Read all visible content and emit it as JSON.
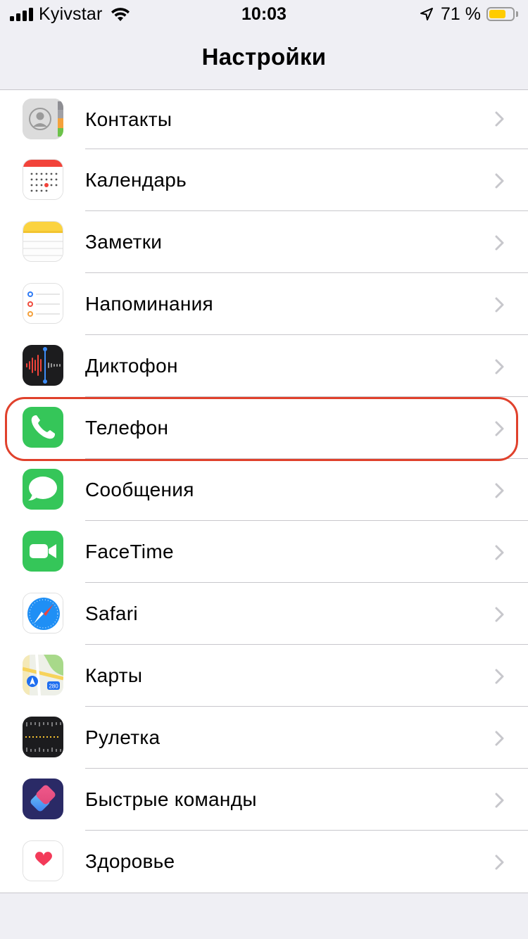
{
  "status_bar": {
    "carrier": "Kyivstar",
    "time": "10:03",
    "battery_text": "71 %",
    "battery_level": 0.71,
    "signal_icon": "cellular-signal-icon",
    "wifi_icon": "wifi-icon",
    "location_icon": "location-arrow-icon",
    "battery_icon": "battery-icon",
    "battery_color": "#ffcc00"
  },
  "nav": {
    "title": "Настройки"
  },
  "highlight_color": "#e0412c",
  "settings": {
    "items": [
      {
        "label": "Контакты",
        "icon": "contacts-icon"
      },
      {
        "label": "Календарь",
        "icon": "calendar-icon"
      },
      {
        "label": "Заметки",
        "icon": "notes-icon"
      },
      {
        "label": "Напоминания",
        "icon": "reminders-icon"
      },
      {
        "label": "Диктофон",
        "icon": "voice-memos-icon"
      },
      {
        "label": "Телефон",
        "icon": "phone-icon",
        "highlighted": true
      },
      {
        "label": "Сообщения",
        "icon": "messages-icon"
      },
      {
        "label": "FaceTime",
        "icon": "facetime-icon"
      },
      {
        "label": "Safari",
        "icon": "safari-icon"
      },
      {
        "label": "Карты",
        "icon": "maps-icon"
      },
      {
        "label": "Рулетка",
        "icon": "measure-icon"
      },
      {
        "label": "Быстрые команды",
        "icon": "shortcuts-icon"
      },
      {
        "label": "Здоровье",
        "icon": "health-icon"
      }
    ]
  }
}
